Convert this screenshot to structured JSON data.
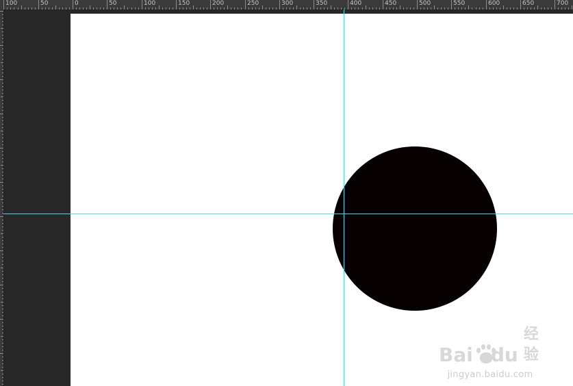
{
  "ruler": {
    "top_labels": [
      "100",
      "50",
      "0",
      "50",
      "100",
      "150",
      "200",
      "250",
      "300",
      "350",
      "400",
      "450",
      "500",
      "550",
      "600",
      "650",
      "700"
    ]
  },
  "canvas": {
    "background_color": "#282828",
    "document_color": "#ffffff",
    "shape_color": "#070000",
    "guide_color": "#4fd6ee"
  },
  "watermark": {
    "logo_left": "Bai",
    "logo_right": "du",
    "logo_cn": "经验",
    "url": "jingyan.baidu.com"
  }
}
